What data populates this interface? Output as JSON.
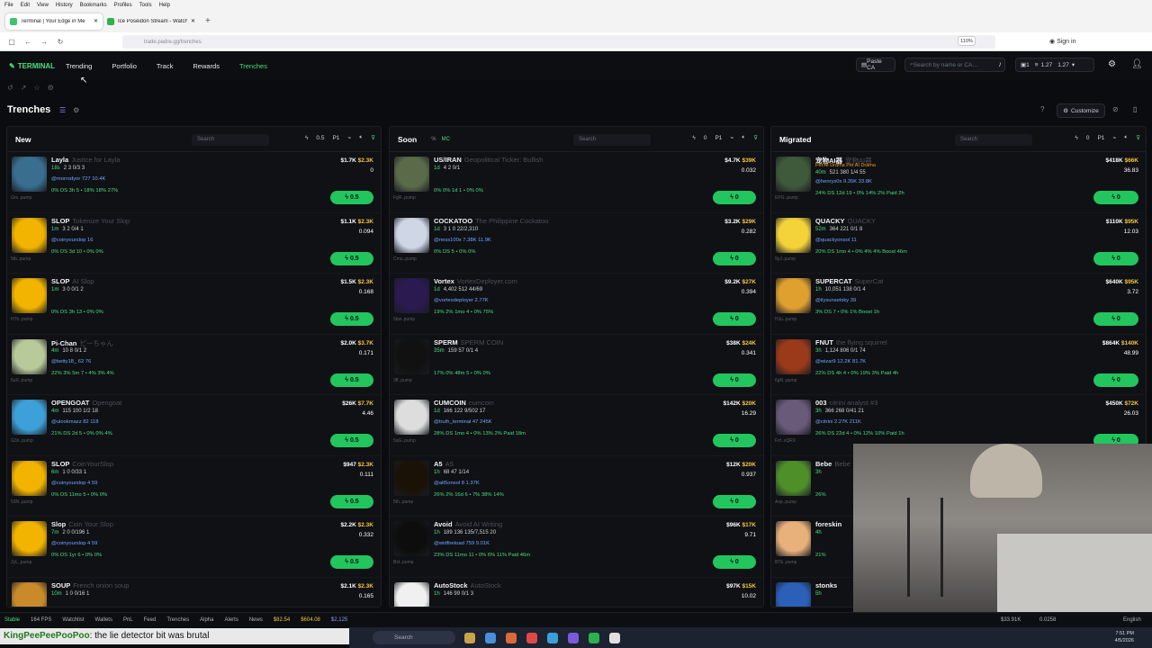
{
  "browser": {
    "menu": [
      "File",
      "Edit",
      "View",
      "History",
      "Bookmarks",
      "Profiles",
      "Tools",
      "Help"
    ],
    "tabs": [
      {
        "label": "Terminal | Your Edge in Me"
      },
      {
        "label": "Ice Poseidon Stream - Watch Li"
      }
    ],
    "url": "trade.padre.gg/trenches",
    "zoom": "110%",
    "signin": "Sign in"
  },
  "app": {
    "logo": "TERMINAL",
    "nav": [
      "Trending",
      "Portfolio",
      "Track",
      "Rewards",
      "Trenches"
    ],
    "paste_ca": "Paste CA",
    "search_placeholder": "Search by name or CA...",
    "search_key": "/",
    "wallet_count": "1",
    "balance1": "1.27",
    "balance2": "1.27",
    "page_title": "Trenches",
    "customize": "Customize"
  },
  "columns": [
    {
      "name": "New",
      "search": "Search",
      "tools": [
        "0.5",
        "P1"
      ],
      "rows": [
        {
          "name": "Layla",
          "sub": "Justice for Layla",
          "age": "18s",
          "stats": "2  3  0/3  3",
          "handle": "@morrodyor  727  10.4K",
          "tags": "0%  DS 3h  5 • 18%  18%  27%",
          "mc": "$1.7K",
          "v": "$2.3K",
          "f": "0",
          "addr": "Grx..pump",
          "buy": "0.5",
          "color": "#3a6e8f"
        },
        {
          "name": "SLOP",
          "sub": "Tokenize Your Slop",
          "age": "1m",
          "stats": "3  2  0/4  1",
          "handle": "@coinyourslop  16",
          "tags": "0%  DS 3d  10 • 0%  0%",
          "mc": "$1.1K",
          "v": "$2.3K",
          "f": "0.094",
          "addr": "5tb..pump",
          "buy": "0.5",
          "color": "#f2b400"
        },
        {
          "name": "SLOP",
          "sub": "AI Slop",
          "age": "1m",
          "stats": "3  0  0/1  2",
          "handle": "",
          "tags": "0%  DS 3h  13 • 0%  0%",
          "mc": "$1.5K",
          "v": "$2.3K",
          "f": "0.168",
          "addr": "H7h..pump",
          "buy": "0.5",
          "color": "#f2b400"
        },
        {
          "name": "Pi-Chan",
          "sub": "ピーちゃん",
          "age": "4m",
          "stats": "10  8  0/1  2",
          "handle": "@betty18_  62  76",
          "tags": "22%  3% 5m  7 • 4%  3%  4%",
          "mc": "$2.0K",
          "v": "$3.7K",
          "f": "0.171",
          "addr": "5uX..pump",
          "buy": "0.5",
          "color": "#b8c99a"
        },
        {
          "name": "OPENGOAT",
          "sub": "Opengoat",
          "age": "4m",
          "stats": "115  100  1/2  18",
          "handle": "@ulookmazz  82  118",
          "tags": "21%  DS 2d  5 • 0%  0%  4%",
          "mc": "$26K",
          "v": "$7.7K",
          "f": "4.46",
          "addr": "G3n..pump",
          "buy": "0.5",
          "color": "#3ea0d8"
        },
        {
          "name": "SLOP",
          "sub": "CoinYourSlop",
          "age": "6m",
          "stats": "1  0  0/33  1",
          "handle": "@coinyourslop  4  59",
          "tags": "0%  DS 11mo  5 • 0%  0%",
          "mc": "$947",
          "v": "$2.3K",
          "f": "0.111",
          "addr": "53N..pump",
          "buy": "0.5",
          "color": "#f2b400"
        },
        {
          "name": "Slop",
          "sub": "Coin Your Slop",
          "age": "7m",
          "stats": "2  0  0/196  1",
          "handle": "@coinyourslop  4  59",
          "tags": "0%  DS 1yr  6 • 0%  0%",
          "mc": "$2.2K",
          "v": "$2.3K",
          "f": "0.332",
          "addr": "2yL..pump",
          "buy": "0.5",
          "color": "#f2b400"
        },
        {
          "name": "SOUP",
          "sub": "French onion soup",
          "age": "10m",
          "stats": "1  0  0/16  1",
          "handle": "",
          "tags": "",
          "mc": "$2.1K",
          "v": "$2.3K",
          "f": "0.165",
          "addr": "",
          "buy": "0.5",
          "color": "#c98a2b"
        }
      ]
    },
    {
      "name": "Soon",
      "search": "Search",
      "tools": [
        "0",
        "P1"
      ],
      "rows": [
        {
          "name": "US/IRAN",
          "sub": "Geopolitical Ticker: Bullish",
          "age": "1d",
          "stats": "4  2  0/1",
          "handle": "",
          "tags": "0%  0% 1d  1 • 0%  0%",
          "mc": "$4.7K",
          "v": "$39K",
          "f": "0.032",
          "addr": "FgR..pump",
          "buy": "0",
          "color": "#5b6b4a"
        },
        {
          "name": "COCKATOO",
          "sub": "The Philippine Cockatoo",
          "age": "1d",
          "stats": "3  1  0  22/2,310",
          "handle": "@ness100x  7.38K  11.9K",
          "tags": "0%  DS  5 • 0%  0%",
          "mc": "$3.2K",
          "v": "$29K",
          "f": "0.282",
          "addr": "Cmu..pump",
          "buy": "0",
          "color": "#cfd7e6"
        },
        {
          "name": "Vortex",
          "sub": "VortexDeployer.com",
          "age": "1d",
          "stats": "4,402  512  44/69",
          "handle": "@vortexdeployer  2.77K",
          "tags": "19%  2% 1mo  4 • 0%  75%",
          "mc": "$9.2K",
          "v": "$27K",
          "f": "0.394",
          "addr": "5bw..pump",
          "buy": "0",
          "color": "#2a1a4f"
        },
        {
          "name": "SPERM",
          "sub": "SPERM COIN",
          "age": "35m",
          "stats": "159  57  0/1  4",
          "handle": "",
          "tags": "17%  0% 48m  5 • 0%  0%",
          "mc": "$38K",
          "v": "$24K",
          "f": "0.341",
          "addr": "3ff..pump",
          "buy": "0",
          "color": "#111111"
        },
        {
          "name": "CUMCOIN",
          "sub": "cumcoin",
          "age": "1d",
          "stats": "166  122  9/502  17",
          "handle": "@truth_terminal  47  245K",
          "tags": "28%  DS 1mo  4 • 0%  13%  2%  Paid 18m",
          "mc": "$142K",
          "v": "$20K",
          "f": "16.29",
          "addr": "5qG..pump",
          "buy": "0",
          "color": "#dddddd"
        },
        {
          "name": "A5",
          "sub": "A5",
          "age": "1h",
          "stats": "68  47  1/14",
          "handle": "@alt5onsol  8  1.37K",
          "tags": "26%  2% 16d  6 • 7%  38%  14%",
          "mc": "$12K",
          "v": "$20K",
          "f": "0.937",
          "addr": "5th..pump",
          "buy": "0",
          "color": "#1a1206"
        },
        {
          "name": "Avoid",
          "sub": "Avoid AI Writing",
          "age": "1h",
          "stats": "189  136  135/7,515  20",
          "handle": "@widfiretoad  759  9.01K",
          "tags": "23%  DS 11mo  11 • 0%  6%  11%  Paid 46m",
          "mc": "$96K",
          "v": "$17K",
          "f": "9.71",
          "addr": "Bst..pump",
          "buy": "0",
          "color": "#0d0d0d"
        },
        {
          "name": "AutoStock",
          "sub": "AutoStock",
          "age": "1h",
          "stats": "146  99  0/1  3",
          "handle": "",
          "tags": "",
          "mc": "$97K",
          "v": "$15K",
          "f": "10.02",
          "addr": "",
          "buy": "0",
          "color": "#f0f0f0"
        }
      ]
    },
    {
      "name": "Migrated",
      "search": "Search",
      "tools": [
        "0",
        "P1"
      ],
      "rows": [
        {
          "name": "宠物AI器",
          "sub": "宠物AI器",
          "extra": "Pet AI Drama  Pet AI Drama",
          "age": "40m",
          "stats": "521  380  1/4  55",
          "handle": "@henrys0x  9.35K  33.8K",
          "tags": "24%  DS 12d  19 • 0%  14%  2%  Paid 2h",
          "mc": "$418K",
          "v": "$66K",
          "f": "36.83",
          "addr": "EPG..pump",
          "buy": "0",
          "color": "#3f5a3a"
        },
        {
          "name": "QUACKY",
          "sub": "QUACKY",
          "age": "52m",
          "stats": "364  221  0/1  8",
          "handle": "@quackyonsol  11",
          "tags": "20%  DS 1mo  4 • 0%  4%  4%  Boost 46m",
          "mc": "$110K",
          "v": "$95K",
          "f": "12.03",
          "addr": "9yJ..pump",
          "buy": "0",
          "color": "#f3d23a"
        },
        {
          "name": "SUPERCAT",
          "sub": "SuperCat",
          "age": "1h",
          "stats": "10,051  138  0/1  4",
          "handle": "@ilysunsetsky  39",
          "tags": "3%  DS  7 • 0%  1%  Boost 1h",
          "mc": "$640K",
          "v": "$95K",
          "f": "3.72",
          "addr": "HJu..pump",
          "buy": "0",
          "color": "#e0a030"
        },
        {
          "name": "FNUT",
          "sub": "the flying squirrel",
          "age": "3h",
          "stats": "1,124  806  0/1  74",
          "handle": "@wizar9  12.2K  81.7K",
          "tags": "22%  DS 4h  4 • 0%  19%  3%  Paid 4h",
          "mc": "$864K",
          "v": "$140K",
          "f": "48.99",
          "addr": "6gN..pump",
          "buy": "0",
          "color": "#9a3a1a"
        },
        {
          "name": "003",
          "sub": "citrini analyst #3",
          "age": "3h",
          "stats": "366  268  0/41  21",
          "handle": "@citrini  2.27K  211K",
          "tags": "26%  DS 22d  4 • 0%  12%  10%  Paid 1h",
          "mc": "$450K",
          "v": "$72K",
          "f": "26.03",
          "addr": "Fzf..vQRX",
          "buy": "0",
          "color": "#6a5a7a"
        },
        {
          "name": "Bebe",
          "sub": "Bebe",
          "age": "3h",
          "stats": "",
          "handle": "",
          "tags": "26%",
          "mc": "",
          "v": "",
          "f": "",
          "addr": "Axp..pump",
          "buy": "0",
          "color": "#4f8f2a"
        },
        {
          "name": "foreskin",
          "sub": "",
          "age": "4h",
          "stats": "",
          "handle": "",
          "tags": "21%",
          "mc": "",
          "v": "",
          "f": "",
          "addr": "BTb..pump",
          "buy": "0",
          "color": "#e8b07a"
        },
        {
          "name": "stonks",
          "sub": "",
          "age": "5h",
          "stats": "",
          "handle": "",
          "tags": "",
          "mc": "",
          "v": "",
          "f": "",
          "addr": "",
          "buy": "0",
          "color": "#2b5fb8"
        }
      ]
    }
  ],
  "footer": {
    "items": [
      "Stable",
      "164 FPS",
      "Watchlist",
      "Wallets",
      "PnL",
      "Feed",
      "Trenches",
      "Alpha",
      "Alerts",
      "News"
    ],
    "sol": "$82.54",
    "eth": "$604.08",
    "btc": "$2,125",
    "right1": "$33.91K",
    "right2": "0.0258",
    "lang": "English"
  },
  "chat": {
    "user": "KingPeePeePooPoo",
    "message": ": the lie detector bit was brutal"
  },
  "taskbar": {
    "search": "Search",
    "time": "7:51 PM",
    "date": "4/5/2026"
  }
}
